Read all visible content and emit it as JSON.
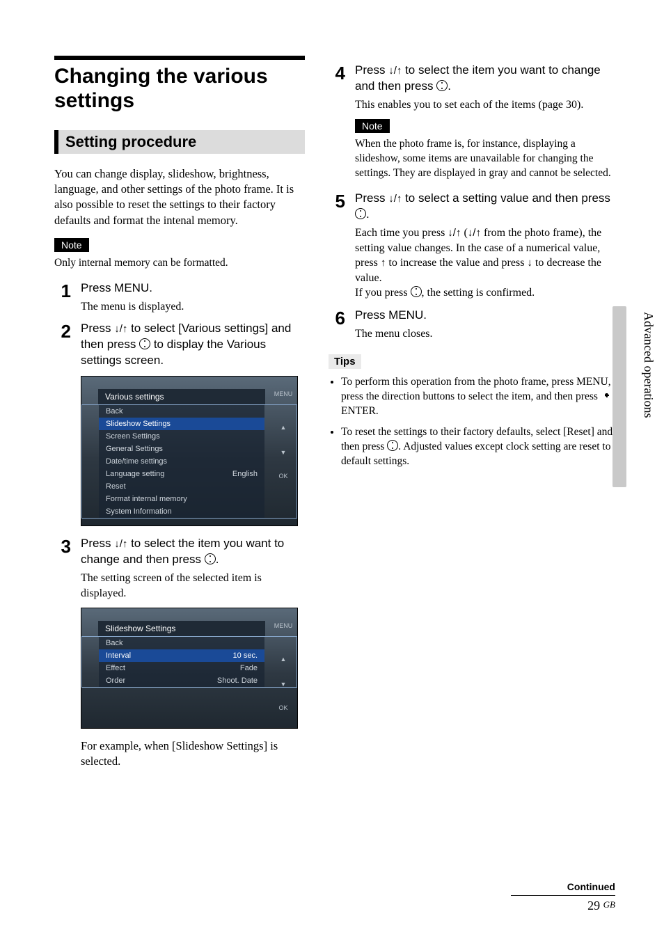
{
  "page": {
    "title": "Changing the various settings",
    "section": "Setting procedure",
    "sidebar_label": "Advanced operations",
    "continued": "Continued",
    "page_number": "29",
    "page_region": "GB"
  },
  "intro": "You can change display, slideshow, brightness, language, and other settings of the photo frame. It is also possible to reset the settings to their factory defaults and format the intenal memory.",
  "note_left_label": "Note",
  "note_left_text": "Only internal memory can be formatted.",
  "steps_left": [
    {
      "num": "1",
      "lead": "Press MENU.",
      "desc": "The menu is displayed."
    },
    {
      "num": "2",
      "lead": "Press ↓/↑ to select [Various settings] and then press ⊕ to display the Various settings screen.",
      "desc": ""
    },
    {
      "num": "3",
      "lead": "Press ↓/↑ to select the item you want to change and then press ⊕.",
      "desc": "The setting screen of the selected item is displayed."
    }
  ],
  "step3_caption": "For example, when [Slideshow Settings] is selected.",
  "steps_right": [
    {
      "num": "4",
      "lead": "Press ↓/↑ to select the item you want to change and then press ⊕.",
      "desc": "This enables you to set each of the items (page 30)."
    },
    {
      "num": "5",
      "lead": "Press ↓/↑ to select a setting value and then press ⊕.",
      "desc": "Each time you press ↓/↑ (↓/↑ from the photo frame), the setting value changes. In the case of a numerical value, press ↑ to increase the value and press ↓ to decrease the value.\nIf you press ⊕, the setting is confirmed."
    },
    {
      "num": "6",
      "lead": "Press MENU.",
      "desc": "The menu closes."
    }
  ],
  "note_right_label": "Note",
  "note_right_text": "When the photo frame is, for instance, displaying a slideshow, some items are unavailable for changing the settings. They are displayed in gray and cannot be selected.",
  "tips_label": "Tips",
  "tips": [
    "To perform this operation from the photo frame, press MENU, press the direction buttons to select the item, and then press  ENTER.",
    "To reset the settings to their factory defaults, select [Reset] and then press ⊕. Adjusted values except clock setting are reset to default settings."
  ],
  "screenshot1": {
    "title": "Various settings",
    "items": [
      "Back",
      "Slideshow Settings",
      "Screen Settings",
      "General Settings",
      "Date/time settings",
      "Language setting",
      "Reset",
      "Format internal memory",
      "System Information"
    ],
    "lang_value": "English",
    "side": {
      "menu": "MENU",
      "ok": "OK"
    }
  },
  "screenshot2": {
    "title": "Slideshow Settings",
    "rows": [
      {
        "label": "Back",
        "value": ""
      },
      {
        "label": "Interval",
        "value": "10 sec."
      },
      {
        "label": "Effect",
        "value": "Fade"
      },
      {
        "label": "Order",
        "value": "Shoot. Date"
      }
    ],
    "side": {
      "menu": "MENU",
      "ok": "OK"
    }
  }
}
